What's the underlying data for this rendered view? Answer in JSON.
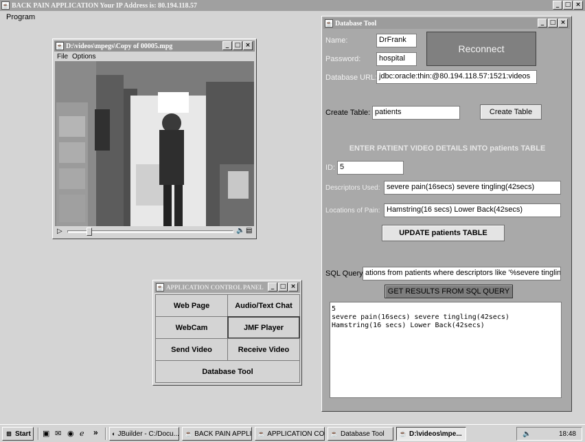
{
  "main_window": {
    "title": "BACK PAIN APPLICATION    Your IP Address is: 80.194.118.57",
    "menu": "Program"
  },
  "video_window": {
    "title": "D:\\videos\\mpegs\\Copy of 00005.mpg",
    "menu": [
      "File",
      "Options"
    ]
  },
  "db_tool": {
    "title": "Database Tool",
    "name_label": "Name:",
    "name_value": "DrFrank",
    "password_label": "Password:",
    "password_value": "hospital",
    "reconnect": "Reconnect",
    "url_label": "Database URL:",
    "url_value": "jdbc:oracle:thin:@80.194.118.57:1521:videos",
    "create_label": "Create Table:",
    "create_value": "patients",
    "create_button": "Create Table",
    "section_heading": "ENTER PATIENT VIDEO DETAILS INTO patients TABLE",
    "id_label": "ID:",
    "id_value": "5",
    "descriptors_label": "Descriptors Used:",
    "descriptors_value": "severe pain(16secs) severe tingling(42secs)",
    "locations_label": "Locations of Pain:",
    "locations_value": "Hamstring(16 secs) Lower Back(42secs)",
    "update_button": "UPDATE patients TABLE",
    "sql_label": "SQL Query",
    "sql_value": "ations from patients where descriptors like '%severe tingling%'",
    "sql_button": "GET RESULTS FROM SQL QUERY",
    "results": [
      "5",
      "severe pain(16secs) severe tingling(42secs)",
      "Hamstring(16 secs) Lower Back(42secs)"
    ]
  },
  "control_panel": {
    "title": "APPLICATION CONTROL PANEL",
    "buttons": [
      "Web Page",
      "Audio/Text Chat",
      "WebCam",
      "JMF Player",
      "Send Video",
      "Receive Video",
      "Database Tool"
    ]
  },
  "taskbar": {
    "start": "Start",
    "quicklaunch_more": "»",
    "tasks": [
      "JBuilder - C:/Docu...",
      "BACK PAIN APPLI...",
      "APPLICATION CO...",
      "Database Tool",
      "D:\\videos\\mpe..."
    ],
    "clock": "18:48"
  }
}
